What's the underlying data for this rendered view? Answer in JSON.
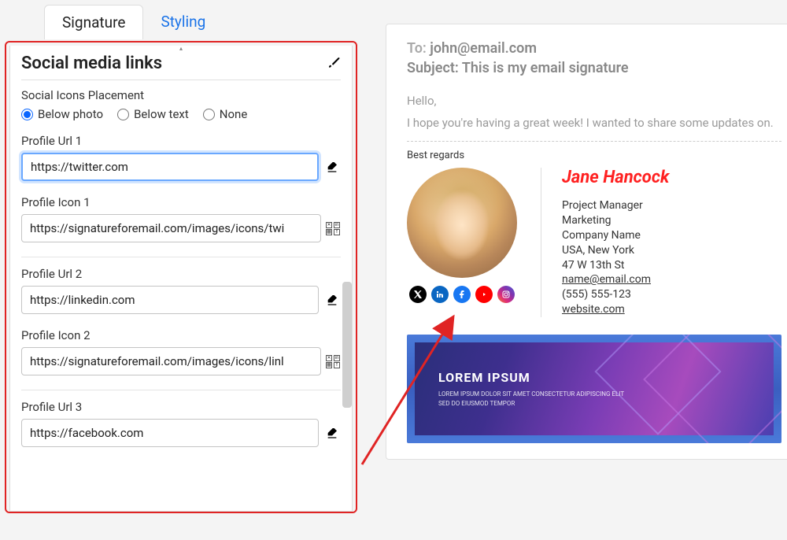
{
  "tabs": {
    "signature": "Signature",
    "styling": "Styling"
  },
  "section": {
    "title": "Social media links",
    "placement_label": "Social Icons Placement",
    "placement_options": {
      "below_photo": "Below photo",
      "below_text": "Below text",
      "none": "None"
    },
    "profiles": {
      "url1_label": "Profile Url 1",
      "url1_value": "https://twitter.com",
      "icon1_label": "Profile Icon 1",
      "icon1_value": "https://signatureforemail.com/images/icons/twi",
      "url2_label": "Profile Url 2",
      "url2_value": "https://linkedin.com",
      "icon2_label": "Profile Icon 2",
      "icon2_value": "https://signatureforemail.com/images/icons/linl",
      "url3_label": "Profile Url 3",
      "url3_value": "https://facebook.com"
    }
  },
  "preview": {
    "to_prefix": "To: ",
    "to": "john@email.com",
    "subject_prefix": "Subject: ",
    "subject": "This is my email signature",
    "hello": "Hello,",
    "body": "I hope you're having a great week! I wanted to share some updates on.",
    "regards": "Best regards",
    "name": "Jane Hancock",
    "role": "Project Manager",
    "dept": "Marketing",
    "company": "Company Name",
    "location": "USA, New York",
    "address": "47 W 13th St",
    "email": "name@email.com",
    "phone": "(555) 555-123",
    "website": "website.com",
    "banner_title": "LOREM IPSUM",
    "banner_sub": "LOREM IPSUM DOLOR SIT AMET CONSECTETUR ADIPISCING ELIT SED DO EIUSMOD TEMPOR"
  },
  "colors": {
    "accent": "#e02424",
    "link": "#1a73e8",
    "sig_name": "#ff2020"
  }
}
